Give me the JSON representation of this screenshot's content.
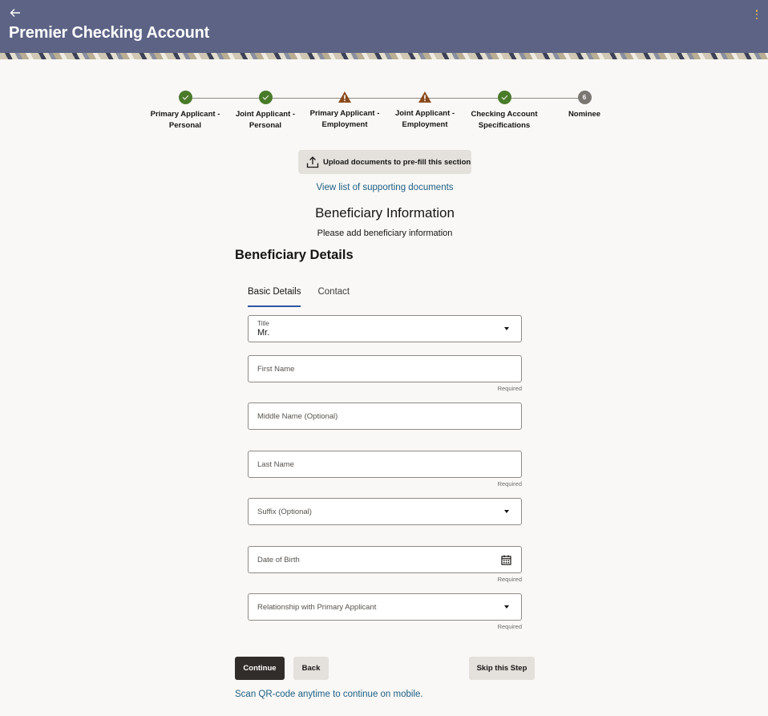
{
  "header": {
    "title": "Premier Checking Account",
    "back_icon": "arrow-left-icon",
    "menu_icon": "kebab-menu-icon",
    "color": "#5c6385"
  },
  "stepper": {
    "steps": [
      {
        "label": "Primary Applicant - Personal",
        "status": "complete"
      },
      {
        "label": "Joint Applicant - Personal",
        "status": "complete"
      },
      {
        "label": "Primary Applicant - Employment",
        "status": "warning"
      },
      {
        "label": "Joint Applicant - Employment",
        "status": "warning"
      },
      {
        "label": "Checking Account Specifications",
        "status": "complete"
      },
      {
        "label": "Nominee",
        "status": "current",
        "number": "6"
      }
    ],
    "colors": {
      "complete": "#4a7b2b",
      "warning": "#8a4a1c",
      "current": "#7a7671"
    }
  },
  "upload": {
    "label": "Upload documents to pre-fill this section",
    "icon": "upload-icon"
  },
  "docs_link": "View list of supporting documents",
  "section": {
    "title": "Beneficiary Information",
    "subtitle": "Please add beneficiary information",
    "details_title": "Beneficiary Details"
  },
  "tabs": [
    {
      "label": "Basic Details",
      "active": true
    },
    {
      "label": "Contact",
      "active": false
    }
  ],
  "form": {
    "title_field": {
      "label": "Title",
      "value": "Mr."
    },
    "first_name": {
      "placeholder": "First Name",
      "helper": "Required"
    },
    "middle_name": {
      "placeholder": "Middle Name (Optional)"
    },
    "last_name": {
      "placeholder": "Last Name",
      "helper": "Required"
    },
    "suffix": {
      "placeholder": "Suffix (Optional)"
    },
    "dob": {
      "placeholder": "Date of Birth",
      "helper": "Required",
      "icon": "calendar-icon"
    },
    "relationship": {
      "placeholder": "Relationship with Primary Applicant",
      "helper": "Required"
    }
  },
  "buttons": {
    "continue": "Continue",
    "back": "Back",
    "skip": "Skip this Step"
  },
  "qr_link": "Scan QR-code anytime to continue on mobile."
}
